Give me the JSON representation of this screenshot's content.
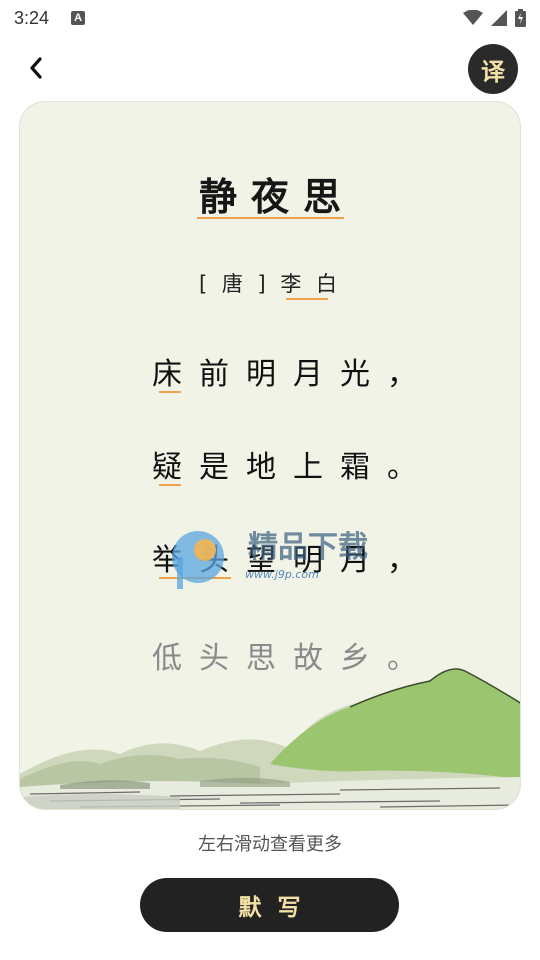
{
  "status_bar": {
    "time": "3:24",
    "notification_icon": "A"
  },
  "header": {
    "back_icon": "chevron-left",
    "translate_label": "译"
  },
  "poem": {
    "title": "静夜思",
    "author": "[ 唐 ] 李 白",
    "lines": [
      "床前明月光，",
      "疑是地上霜。",
      "举头望明月，",
      "低头思故乡。"
    ]
  },
  "watermark": {
    "brand": "精品下载",
    "url": "www.j9p.com"
  },
  "hint": "左右滑动查看更多",
  "dictation_button": "默写",
  "colors": {
    "accent_underline": "#f0a24a",
    "button_bg": "#222222",
    "button_text": "#f2e0a6",
    "card_bg": "#f1f3e7"
  }
}
